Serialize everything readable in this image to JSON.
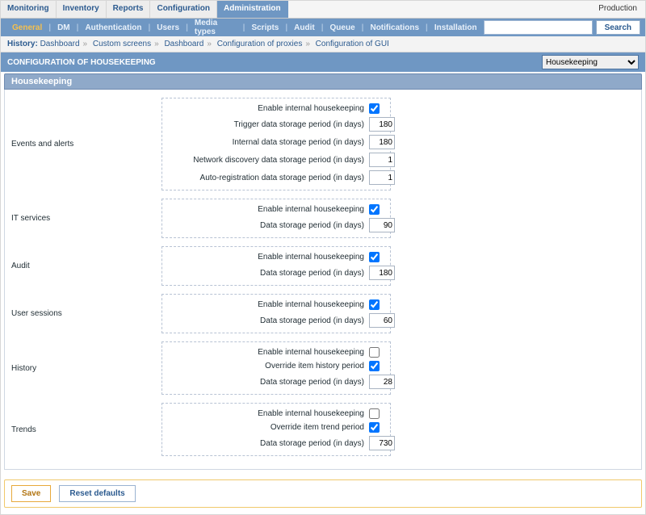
{
  "env_label": "Production",
  "tabs": {
    "items": [
      "Monitoring",
      "Inventory",
      "Reports",
      "Configuration",
      "Administration"
    ],
    "active_index": 4
  },
  "menu": {
    "items": [
      "General",
      "DM",
      "Authentication",
      "Users",
      "Media types",
      "Scripts",
      "Audit",
      "Queue",
      "Notifications",
      "Installation"
    ],
    "active_index": 0,
    "search_placeholder": "",
    "search_button": "Search"
  },
  "history": {
    "label": "History:",
    "crumbs": [
      "Dashboard",
      "Custom screens",
      "Dashboard",
      "Configuration of proxies",
      "Configuration of GUI"
    ]
  },
  "section": {
    "title": "CONFIGURATION OF HOUSEKEEPING",
    "dropdown_selected": "Housekeeping"
  },
  "panel_title": "Housekeeping",
  "form": {
    "events": {
      "section_label": "Events and alerts",
      "enable_label": "Enable internal housekeeping",
      "enable_checked": true,
      "trigger_label": "Trigger data storage period (in days)",
      "trigger_value": "180",
      "internal_label": "Internal data storage period (in days)",
      "internal_value": "180",
      "netdisc_label": "Network discovery data storage period (in days)",
      "netdisc_value": "1",
      "autoreg_label": "Auto-registration data storage period (in days)",
      "autoreg_value": "1"
    },
    "services": {
      "section_label": "IT services",
      "enable_label": "Enable internal housekeeping",
      "enable_checked": true,
      "period_label": "Data storage period (in days)",
      "period_value": "90"
    },
    "audit": {
      "section_label": "Audit",
      "enable_label": "Enable internal housekeeping",
      "enable_checked": true,
      "period_label": "Data storage period (in days)",
      "period_value": "180"
    },
    "sessions": {
      "section_label": "User sessions",
      "enable_label": "Enable internal housekeeping",
      "enable_checked": true,
      "period_label": "Data storage period (in days)",
      "period_value": "60"
    },
    "history": {
      "section_label": "History",
      "enable_label": "Enable internal housekeeping",
      "enable_checked": false,
      "override_label": "Override item history period",
      "override_checked": true,
      "period_label": "Data storage period (in days)",
      "period_value": "28"
    },
    "trends": {
      "section_label": "Trends",
      "enable_label": "Enable internal housekeeping",
      "enable_checked": false,
      "override_label": "Override item trend period",
      "override_checked": true,
      "period_label": "Data storage period (in days)",
      "period_value": "730"
    }
  },
  "buttons": {
    "save": "Save",
    "reset": "Reset defaults"
  }
}
